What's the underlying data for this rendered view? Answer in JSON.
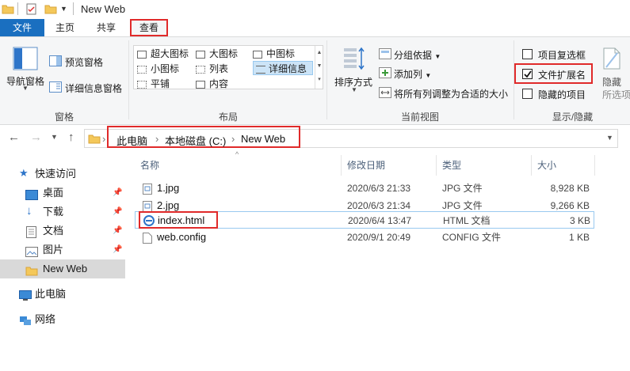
{
  "window": {
    "title": "New Web"
  },
  "tabs": {
    "file": "文件",
    "home": "主页",
    "share": "共享",
    "view": "查看"
  },
  "ribbon": {
    "panes": {
      "navigation_pane": "导航窗格",
      "preview_pane": "预览窗格",
      "details_pane": "详细信息窗格",
      "label": "窗格"
    },
    "layout": {
      "label": "布局",
      "items": [
        "超大图标",
        "大图标",
        "中图标",
        "小图标",
        "列表",
        "详细信息",
        "平铺",
        "内容"
      ],
      "selected": "详细信息"
    },
    "current_view": {
      "sort_by": "排序方式",
      "group_by": "分组依据",
      "add_columns": "添加列",
      "size_columns": "将所有列调整为合适的大小",
      "label": "当前视图"
    },
    "show_hide": {
      "item_checkboxes": "项目复选框",
      "item_checkboxes_checked": false,
      "file_extensions": "文件扩展名",
      "file_extensions_checked": true,
      "hidden_items": "隐藏的项目",
      "hidden_items_checked": false,
      "hide": "隐藏",
      "hide_selected": "所选项目",
      "label": "显示/隐藏"
    }
  },
  "address": {
    "crumbs": [
      "此电脑",
      "本地磁盘 (C:)",
      "New Web"
    ]
  },
  "nav_pane": {
    "quick_access": "快速访问",
    "items": [
      {
        "label": "桌面",
        "pinned": true
      },
      {
        "label": "下载",
        "pinned": true
      },
      {
        "label": "文档",
        "pinned": true
      },
      {
        "label": "图片",
        "pinned": true
      },
      {
        "label": "New Web",
        "pinned": false
      }
    ],
    "this_pc": "此电脑",
    "network": "网络"
  },
  "file_list": {
    "columns": {
      "name": "名称",
      "modified": "修改日期",
      "type": "类型",
      "size": "大小"
    },
    "rows": [
      {
        "name": "1.jpg",
        "modified": "2020/6/3 21:33",
        "type": "JPG 文件",
        "size": "8,928 KB"
      },
      {
        "name": "2.jpg",
        "modified": "2020/6/3 21:34",
        "type": "JPG 文件",
        "size": "9,266 KB"
      },
      {
        "name": "index.html",
        "modified": "2020/6/4 13:47",
        "type": "HTML 文档",
        "size": "3 KB"
      },
      {
        "name": "web.config",
        "modified": "2020/9/1 20:49",
        "type": "CONFIG 文件",
        "size": "1 KB"
      }
    ]
  },
  "colors": {
    "accent": "#1a6fc0",
    "highlight": "#e02a2a",
    "selection": "#cce4f7"
  }
}
